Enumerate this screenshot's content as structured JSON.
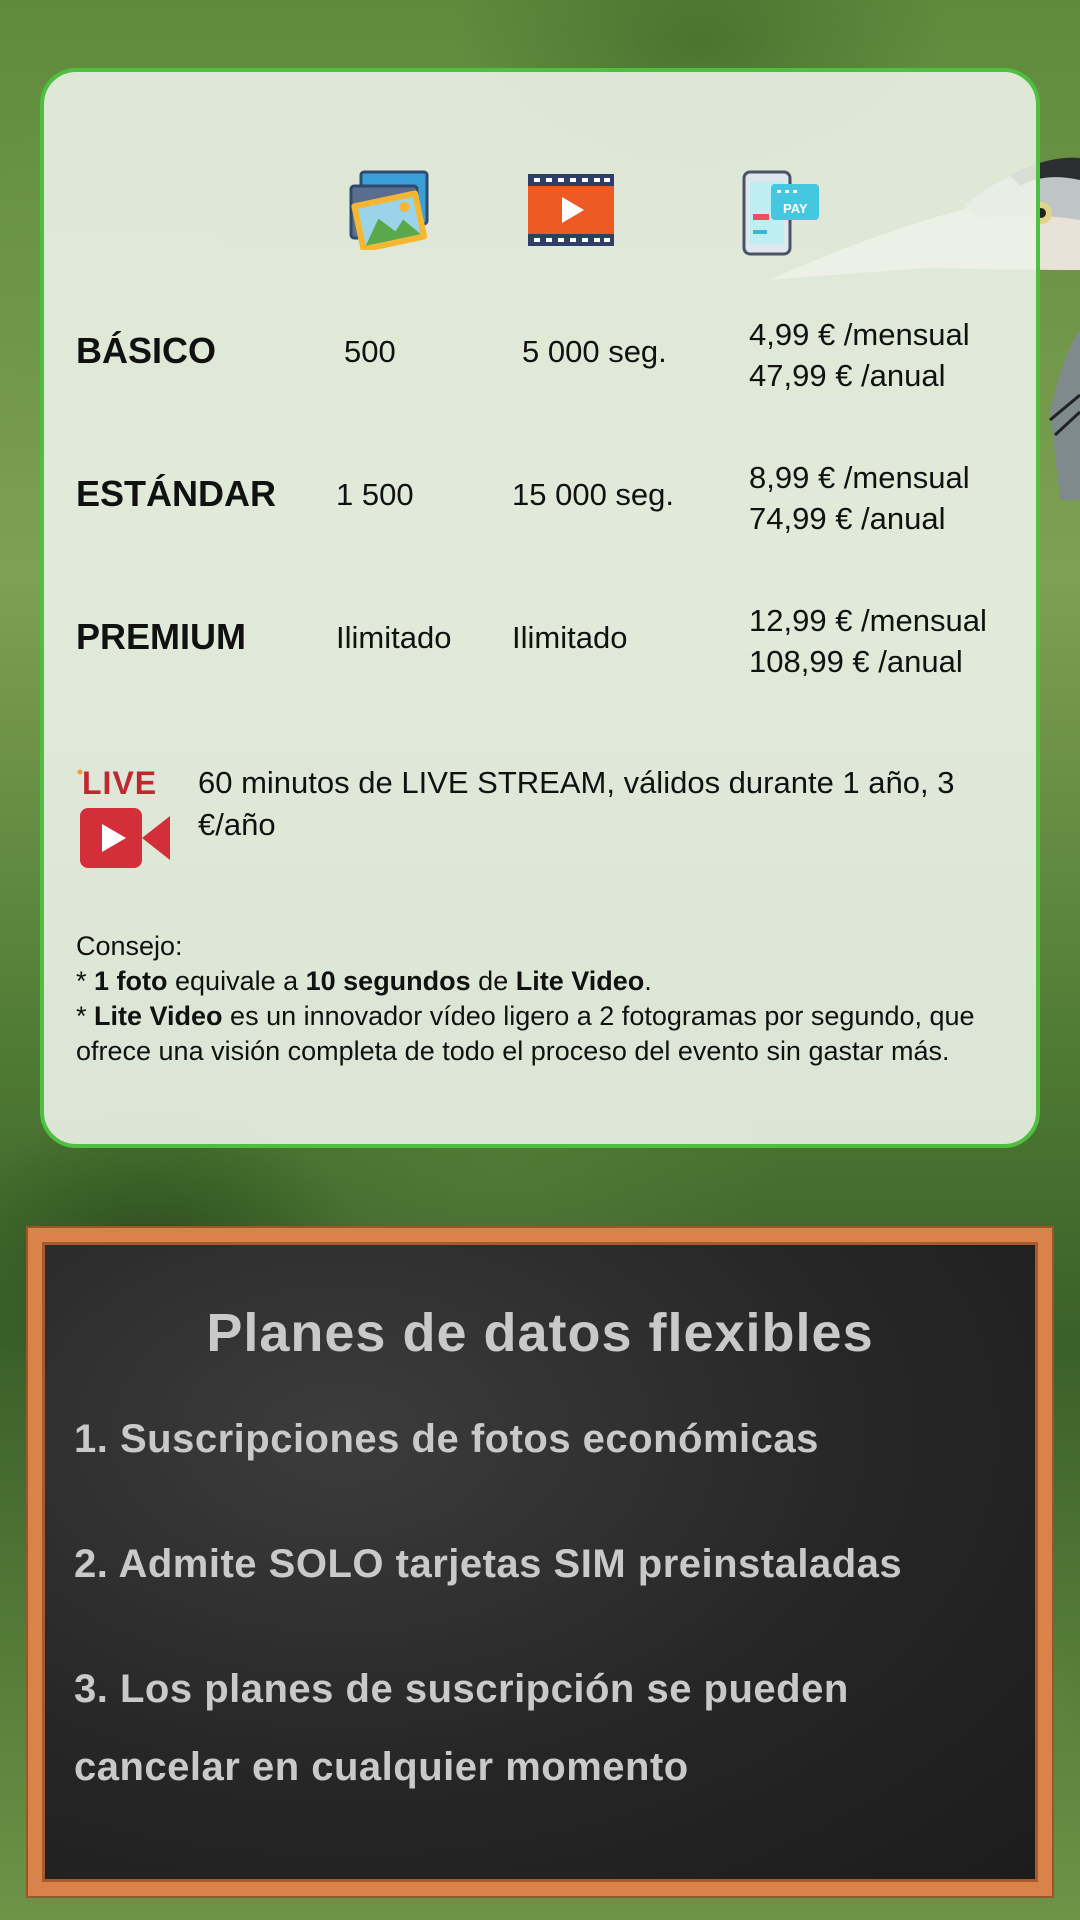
{
  "plans": [
    {
      "name": "BÁSICO",
      "photos": "500",
      "video": "5 000 seg.",
      "monthly": "4,99 € /mensual",
      "yearly": "47,99 € /anual"
    },
    {
      "name": "ESTÁNDAR",
      "photos": "1 500",
      "video": "15 000 seg.",
      "monthly": "8,99 € /mensual",
      "yearly": "74,99 € /anual"
    },
    {
      "name": "PREMIUM",
      "photos": "Ilimitado",
      "video": "Ilimitado",
      "monthly": "12,99 € /mensual",
      "yearly": "108,99 € /anual"
    }
  ],
  "icons": {
    "photos": "photos-icon",
    "video": "video-icon",
    "pay": "phone-pay-icon",
    "pay_label": "PAY",
    "live": "live-camera-icon",
    "live_label": "LIVE"
  },
  "live": {
    "text": "60 minutos de LIVE STREAM, válidos durante 1 año, 3 €/año"
  },
  "tips": {
    "title": "Consejo:",
    "line1": {
      "prefix": "* ",
      "b1": "1 foto",
      "t1": " equivale a ",
      "b2": "10 segundos",
      "t2": " de ",
      "b3": "Lite Video",
      "t3": "."
    },
    "line2": {
      "prefix": "* ",
      "b1": "Lite Video",
      "t1": " es un innovador vídeo ligero a 2 fotogramas por segundo, que ofrece una visión completa de todo el proceso del evento sin gastar más."
    }
  },
  "board": {
    "title": "Planes de datos flexibles",
    "items": [
      "1. Suscripciones de fotos económicas",
      "2. Admite SOLO tarjetas SIM preinstaladas",
      "3. Los planes de suscripción se pueden cancelar en cualquier momento"
    ]
  },
  "colors": {
    "card_border": "#4fbf3f",
    "live_red": "#d32f3a",
    "board_frame": "#d9824a",
    "chalk": "#c9c9c9"
  }
}
